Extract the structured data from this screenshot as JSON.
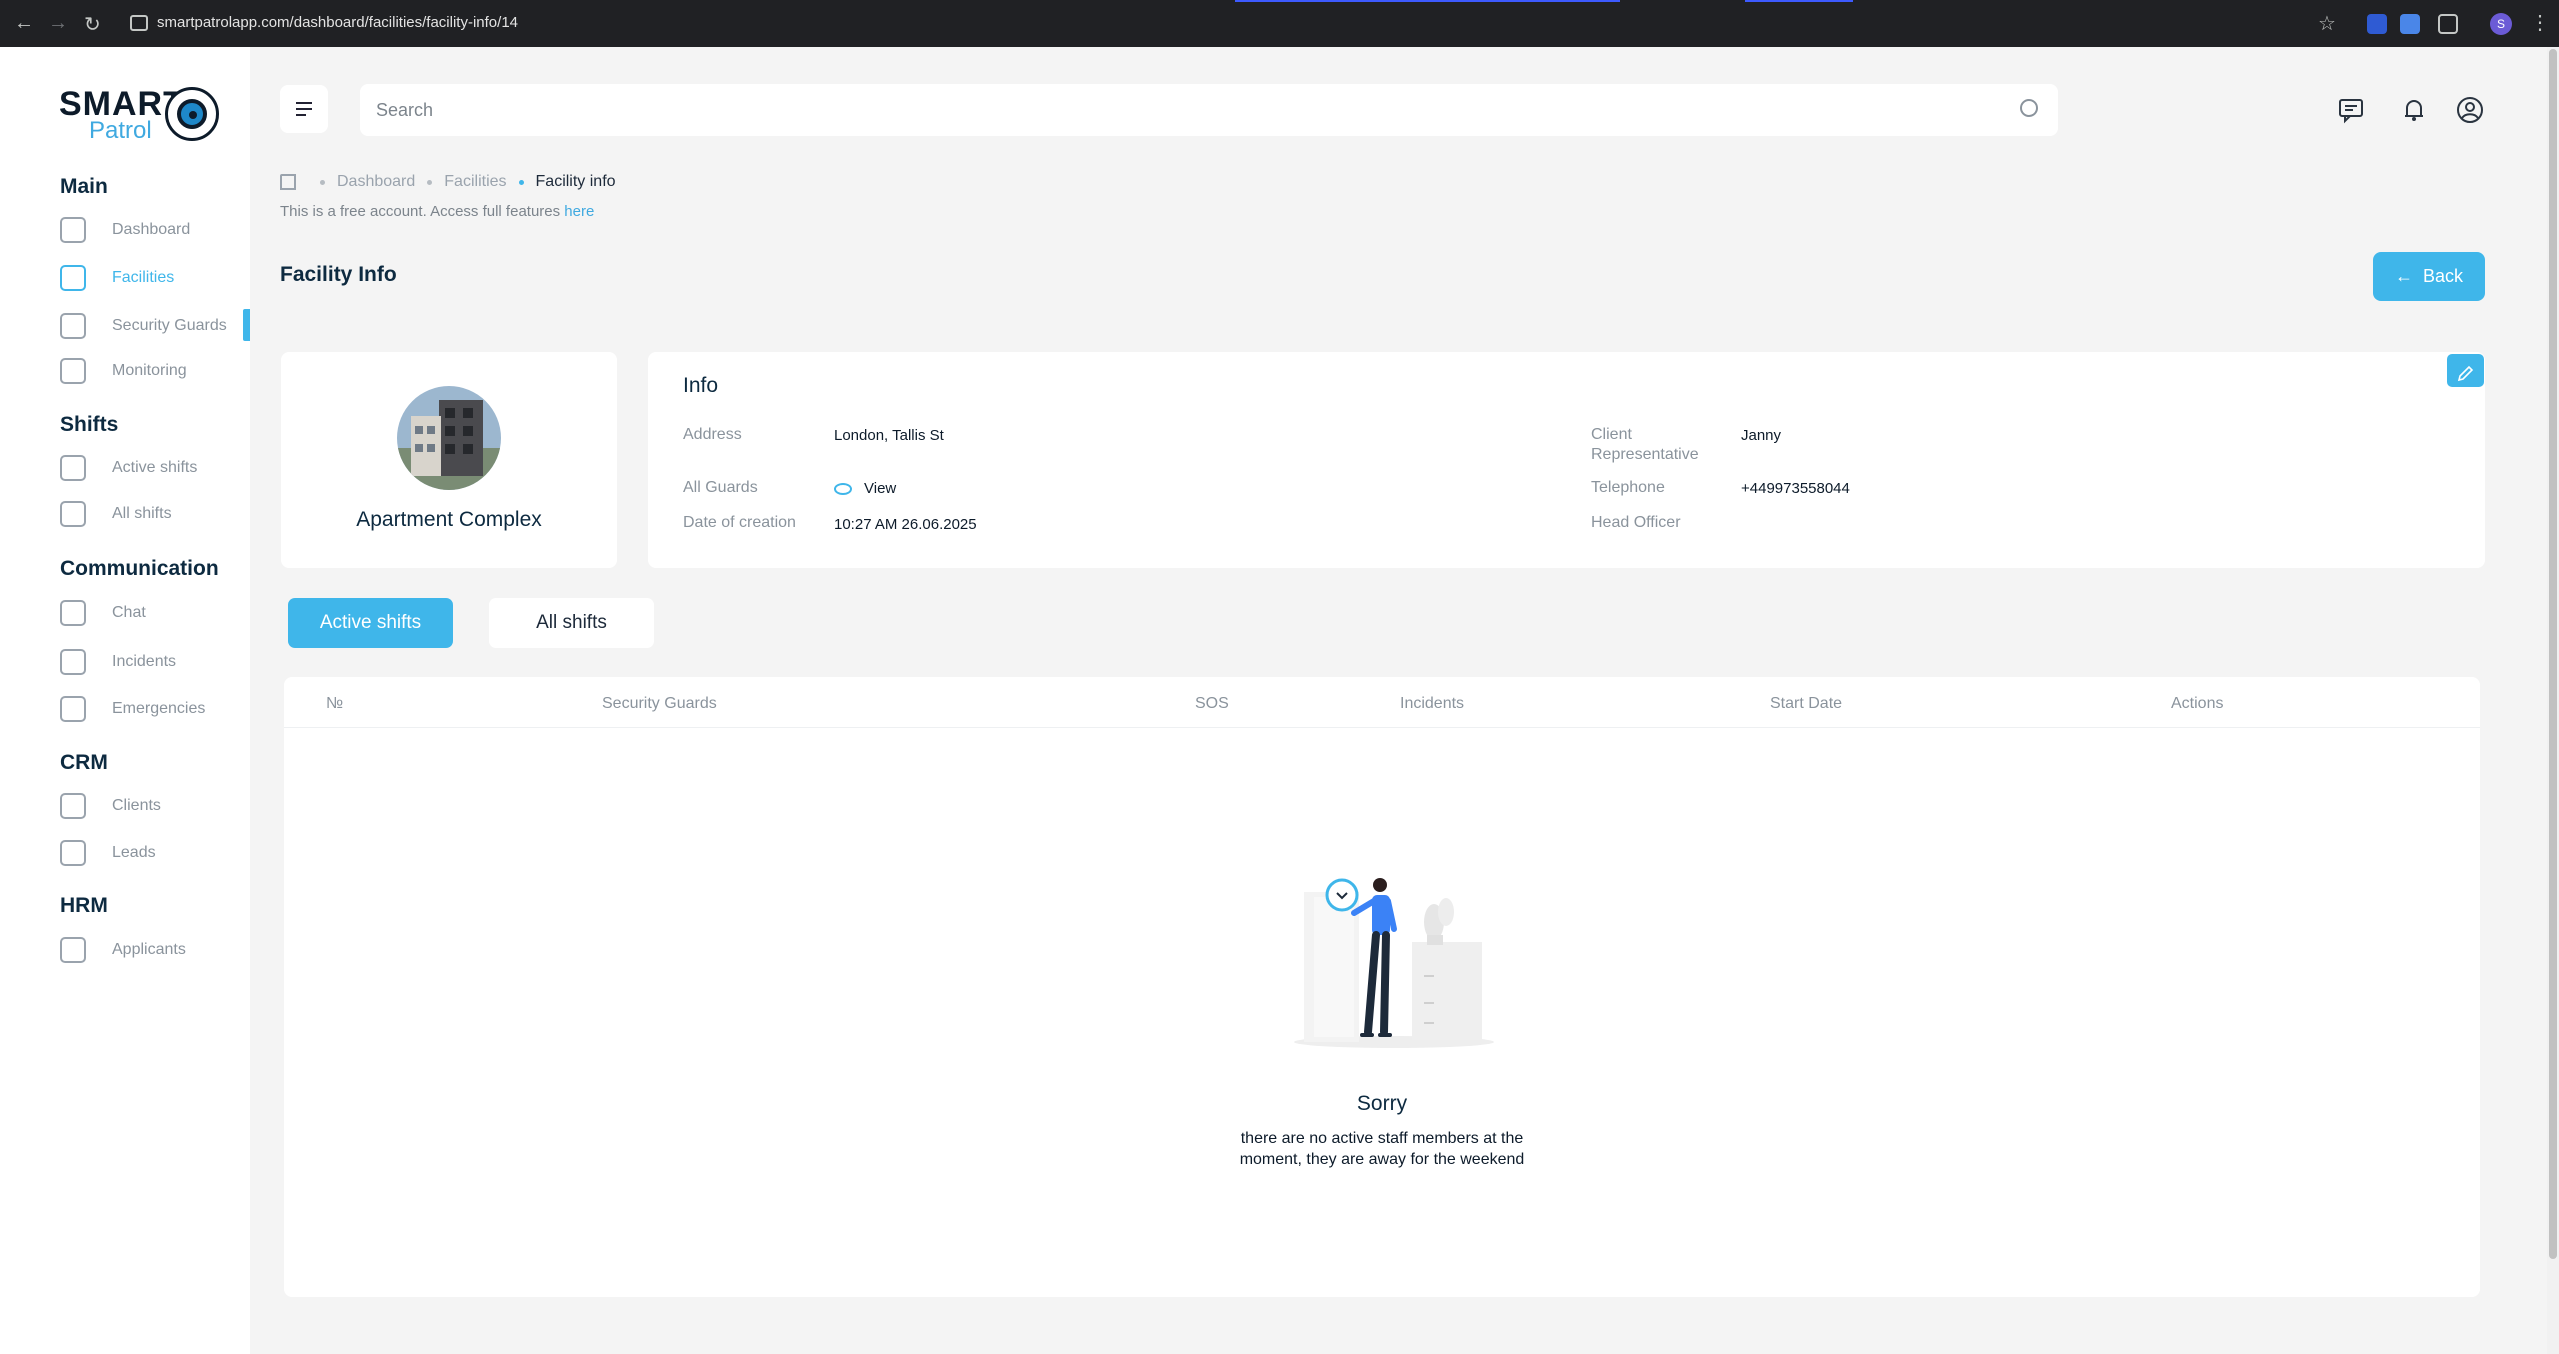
{
  "browser": {
    "url": "smartpatrolapp.com/dashboard/facilities/facility-info/14",
    "profile_initial": "S"
  },
  "logo": {
    "smart": "SMART",
    "patrol": "Patrol"
  },
  "sidebar": {
    "sections": [
      {
        "title": "Main",
        "items": [
          {
            "label": "Dashboard",
            "icon": "dashboard-icon"
          },
          {
            "label": "Facilities",
            "icon": "building-icon",
            "active": true
          },
          {
            "label": "Security Guards",
            "icon": "guard-icon"
          },
          {
            "label": "Monitoring",
            "icon": "monitor-icon"
          }
        ]
      },
      {
        "title": "Shifts",
        "items": [
          {
            "label": "Active shifts",
            "icon": "active-shift-icon"
          },
          {
            "label": "All shifts",
            "icon": "all-shifts-icon"
          }
        ]
      },
      {
        "title": "Communication",
        "items": [
          {
            "label": "Chat",
            "icon": "chat-icon"
          },
          {
            "label": "Incidents",
            "icon": "incident-icon"
          },
          {
            "label": "Emergencies",
            "icon": "siren-icon"
          }
        ]
      },
      {
        "title": "CRM",
        "items": [
          {
            "label": "Clients",
            "icon": "clients-icon"
          },
          {
            "label": "Leads",
            "icon": "leads-icon"
          }
        ]
      },
      {
        "title": "HRM",
        "items": [
          {
            "label": "Applicants",
            "icon": "applicant-icon"
          }
        ]
      }
    ]
  },
  "search": {
    "placeholder": "Search"
  },
  "breadcrumb": {
    "items": [
      "Dashboard",
      "Facilities",
      "Facility info"
    ]
  },
  "free_note": {
    "text": "This is a free account. Access full features ",
    "link": "here"
  },
  "page": {
    "title": "Facility Info",
    "back_label": "Back"
  },
  "facility": {
    "name": "Apartment Complex"
  },
  "info": {
    "title": "Info",
    "address_label": "Address",
    "address_value": "London, Tallis St",
    "guards_label": "All Guards",
    "guards_value": "View",
    "created_label": "Date of creation",
    "created_value": "10:27 AM 26.06.2025",
    "rep_label_1": "Client",
    "rep_label_2": "Representative",
    "rep_value": "Janny",
    "phone_label": "Telephone",
    "phone_value": "+449973558044",
    "head_label": "Head Officer"
  },
  "tabs": {
    "active": "Active shifts",
    "all": "All shifts"
  },
  "table": {
    "columns": [
      "№",
      "Security Guards",
      "SOS",
      "Incidents",
      "Start Date",
      "Actions"
    ]
  },
  "empty": {
    "title": "Sorry",
    "message": "there are no active staff members at the moment, they are away for the weekend"
  },
  "colors": {
    "accent": "#3fb6ea",
    "navy": "#0d2a40",
    "bg": "#f4f4f4"
  }
}
